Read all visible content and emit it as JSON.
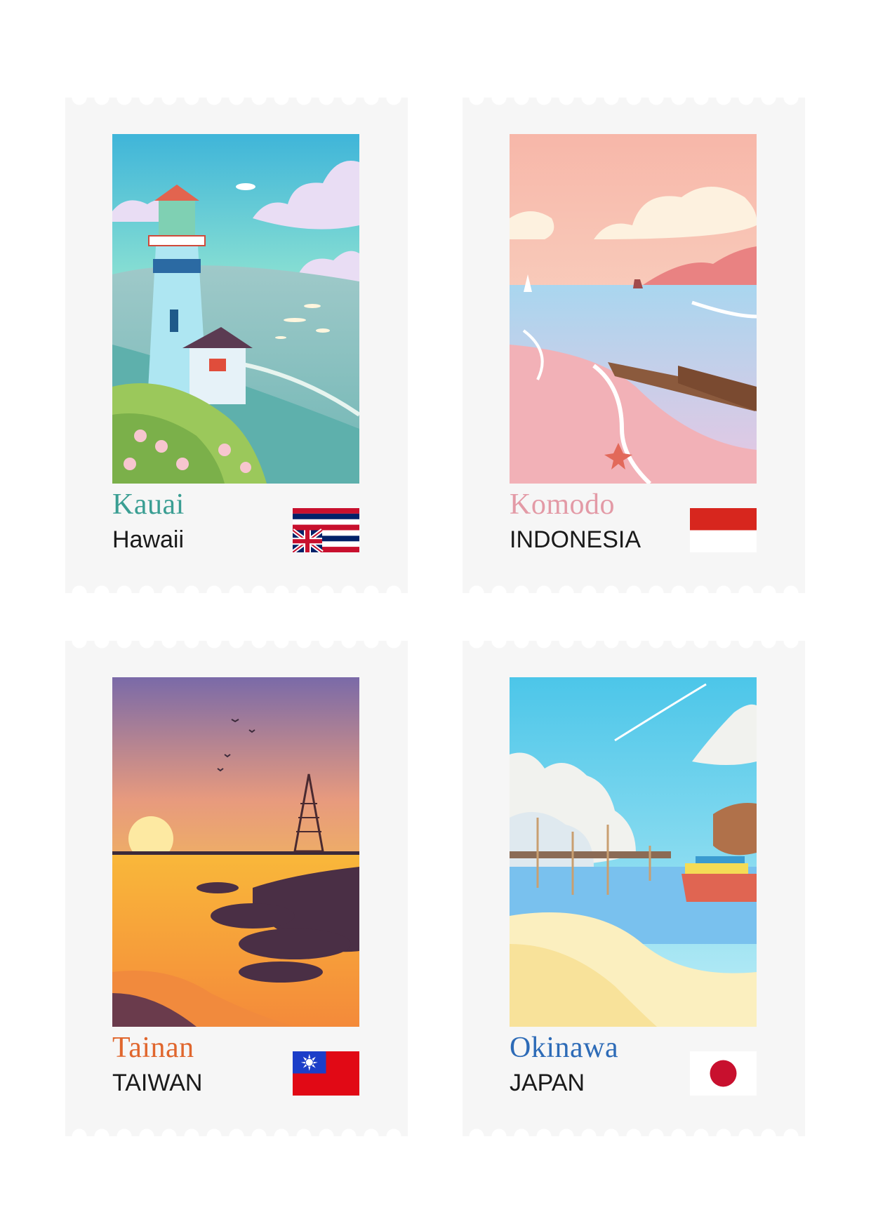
{
  "stamps": [
    {
      "city": "Kauai",
      "region": "Hawaii",
      "city_color": "#3a9e93"
    },
    {
      "city": "Komodo",
      "region": "INDONESIA",
      "city_color": "#e39aa6"
    },
    {
      "city": "Tainan",
      "region": "TAIWAN",
      "city_color": "#e0662d"
    },
    {
      "city": "Okinawa",
      "region": "JAPAN",
      "city_color": "#2d6bb7"
    }
  ],
  "colors": {
    "stamp_paper": "#f6f6f6",
    "region_text": "#1a1a1a"
  }
}
